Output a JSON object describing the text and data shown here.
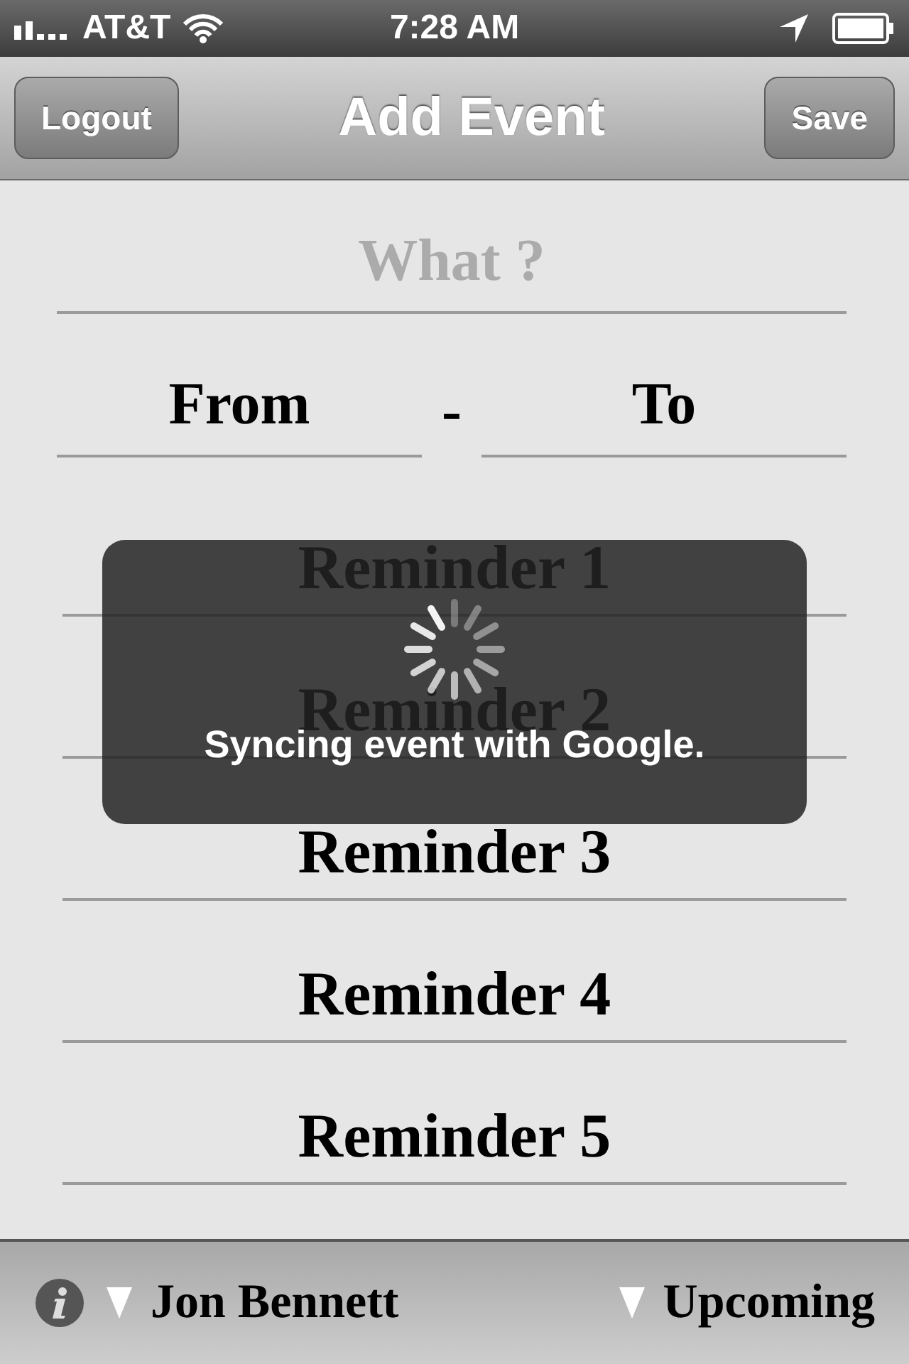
{
  "status_bar": {
    "carrier": "AT&T",
    "time": "7:28 AM"
  },
  "nav": {
    "left_button": "Logout",
    "title": "Add Event",
    "right_button": "Save"
  },
  "form": {
    "what": {
      "placeholder": "What ?"
    },
    "from": {
      "label": "From"
    },
    "separator": "-",
    "to": {
      "label": "To"
    },
    "reminders": [
      {
        "label": "Reminder 1"
      },
      {
        "label": "Reminder 2"
      },
      {
        "label": "Reminder 3"
      },
      {
        "label": "Reminder 4"
      },
      {
        "label": "Reminder 5"
      }
    ]
  },
  "toast": {
    "message": "Syncing event with Google."
  },
  "bottom_bar": {
    "account": "Jon Bennett",
    "view": "Upcoming"
  }
}
